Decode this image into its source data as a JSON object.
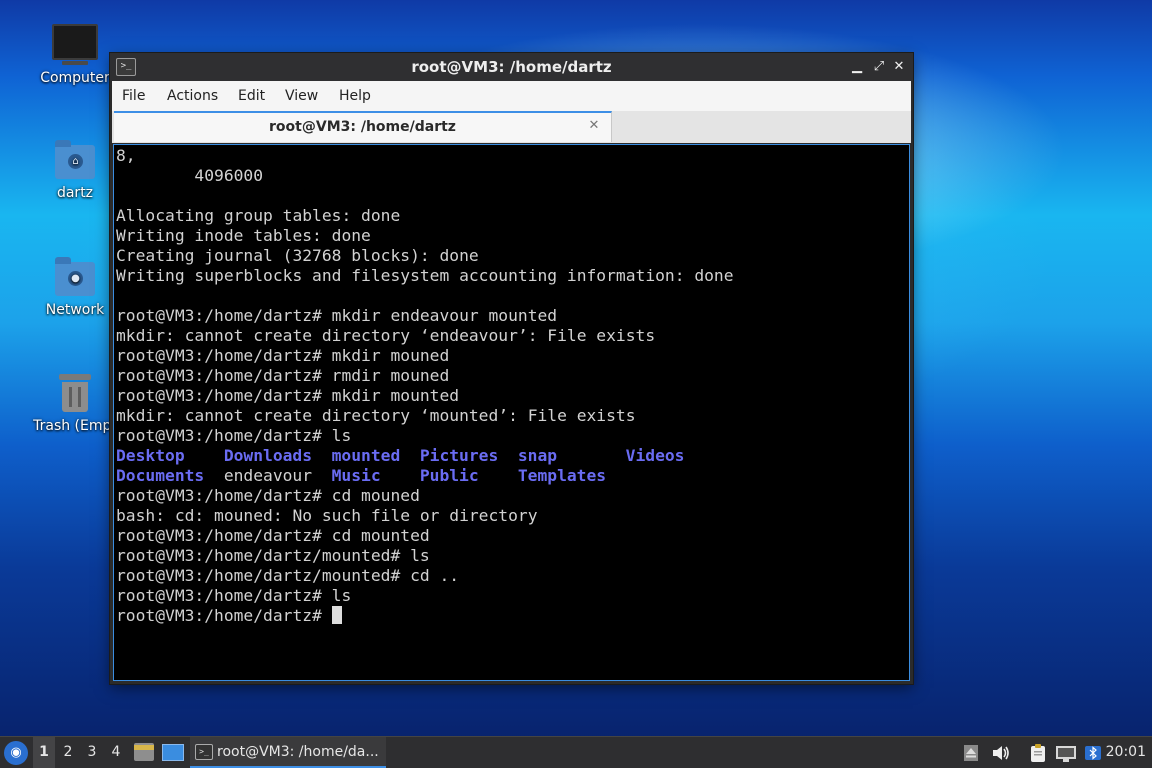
{
  "desktop": {
    "icons": [
      {
        "label": "Computer",
        "icon": "monitor-icon"
      },
      {
        "label": "dartz",
        "icon": "home-folder-icon"
      },
      {
        "label": "Network",
        "icon": "network-folder-icon"
      },
      {
        "label": "Trash (Empt",
        "icon": "trash-icon"
      }
    ]
  },
  "window": {
    "title": "root@VM3: /home/dartz",
    "app_icon": ">_",
    "controls": {
      "minimize": "▁",
      "maximize": "⤢",
      "close": "✕"
    },
    "menu": [
      "File",
      "Actions",
      "Edit",
      "View",
      "Help"
    ],
    "tab": {
      "title": "root@VM3: /home/dartz",
      "close": "✕"
    }
  },
  "terminal": {
    "lines": [
      "8,",
      "        4096000",
      "",
      "Allocating group tables: done",
      "Writing inode tables: done",
      "Creating journal (32768 blocks): done",
      "Writing superblocks and filesystem accounting information: done",
      "",
      "root@VM3:/home/dartz# mkdir endeavour mounted",
      "mkdir: cannot create directory ‘endeavour’: File exists",
      "root@VM3:/home/dartz# mkdir mouned",
      "root@VM3:/home/dartz# rmdir mouned",
      "root@VM3:/home/dartz# mkdir mounted",
      "mkdir: cannot create directory ‘mounted’: File exists",
      "root@VM3:/home/dartz# ls"
    ],
    "ls_rows": [
      [
        {
          "text": "Desktop",
          "dir": true
        },
        {
          "text": "Downloads",
          "dir": true
        },
        {
          "text": "mounted",
          "dir": true
        },
        {
          "text": "Pictures",
          "dir": true
        },
        {
          "text": "snap",
          "dir": true
        },
        {
          "text": "Videos",
          "dir": true
        }
      ],
      [
        {
          "text": "Documents",
          "dir": true
        },
        {
          "text": "endeavour",
          "dir": false
        },
        {
          "text": "Music",
          "dir": true
        },
        {
          "text": "Public",
          "dir": true
        },
        {
          "text": "Templates",
          "dir": true
        }
      ]
    ],
    "lines_after": [
      "root@VM3:/home/dartz# cd mouned",
      "bash: cd: mouned: No such file or directory",
      "root@VM3:/home/dartz# cd mounted",
      "root@VM3:/home/dartz/mounted# ls",
      "root@VM3:/home/dartz/mounted# cd ..",
      "root@VM3:/home/dartz# ls"
    ],
    "prompt": "root@VM3:/home/dartz# ",
    "colors": {
      "text": "#d2d2d2",
      "directory": "#6a6cf2",
      "background": "#000000"
    }
  },
  "taskbar": {
    "workspaces": [
      "1",
      "2",
      "3",
      "4"
    ],
    "active_workspace": "1",
    "task_label": "root@VM3: /home/da...",
    "tray_icons": [
      "eject-icon",
      "volume-icon",
      "clipboard-icon",
      "network-icon",
      "bluetooth-icon"
    ],
    "clock": "20:01"
  }
}
